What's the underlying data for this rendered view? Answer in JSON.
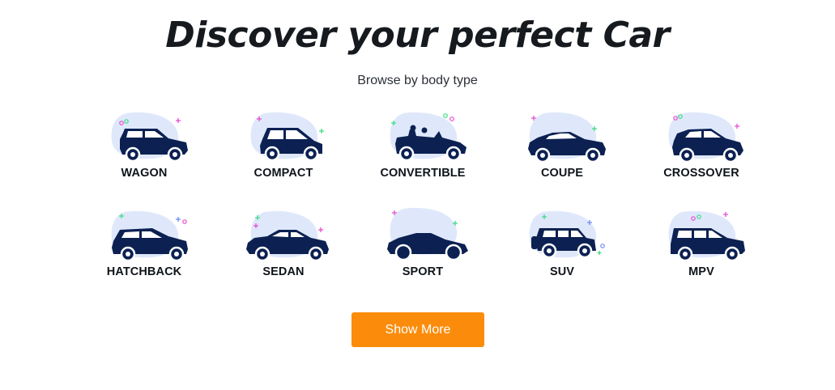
{
  "heading": "Discover your perfect Car",
  "subheading": "Browse by body type",
  "body_types": [
    {
      "label": "WAGON",
      "icon": "wagon-icon"
    },
    {
      "label": "COMPACT",
      "icon": "compact-icon"
    },
    {
      "label": "CONVERTIBLE",
      "icon": "convertible-icon"
    },
    {
      "label": "COUPE",
      "icon": "coupe-icon"
    },
    {
      "label": "CROSSOVER",
      "icon": "crossover-icon"
    },
    {
      "label": "HATCHBACK",
      "icon": "hatchback-icon"
    },
    {
      "label": "SEDAN",
      "icon": "sedan-icon"
    },
    {
      "label": "SPORT",
      "icon": "sport-icon"
    },
    {
      "label": "SUV",
      "icon": "suv-icon"
    },
    {
      "label": "MPV",
      "icon": "mpv-icon"
    }
  ],
  "show_more_label": "Show More",
  "colors": {
    "car_body": "#0c2152",
    "blob": "#dfe8fb",
    "button": "#fb8c0b",
    "sparkle_green": "#3ddc84",
    "sparkle_pink": "#e84bd1",
    "sparkle_blue": "#6d8cf5"
  }
}
